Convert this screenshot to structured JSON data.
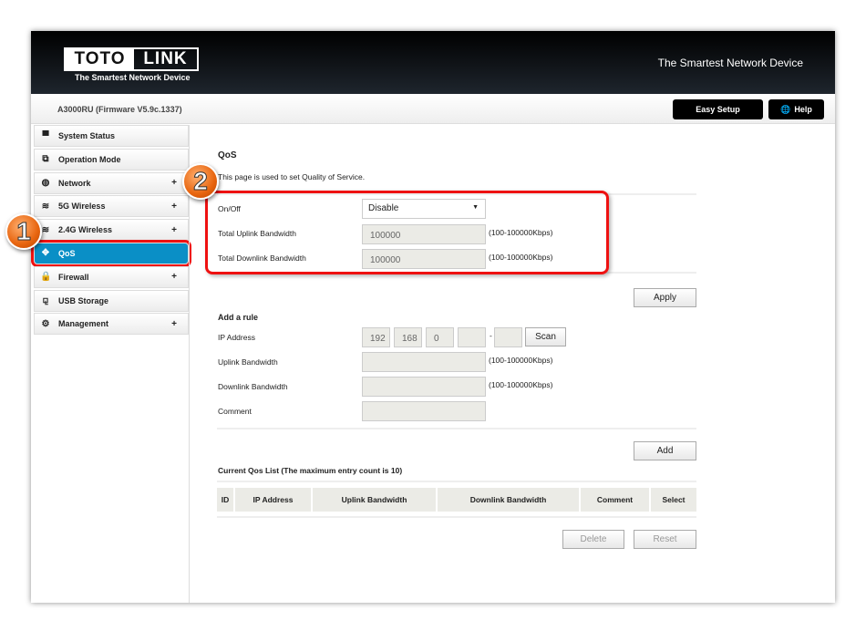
{
  "header": {
    "logo_left": "TOTO",
    "logo_right": "LINK",
    "logo_tagline": "The Smartest Network Device",
    "tagline": "The Smartest Network Device"
  },
  "subbar": {
    "model": "A3000RU (Firmware V5.9c.1337)",
    "easy_setup": "Easy Setup",
    "help": "Help"
  },
  "sidebar": {
    "items": [
      {
        "label": "System Status",
        "icon": "monitor-icon",
        "plus": ""
      },
      {
        "label": "Operation Mode",
        "icon": "windows-icon",
        "plus": ""
      },
      {
        "label": "Network",
        "icon": "globe-icon",
        "plus": "+"
      },
      {
        "label": "5G Wireless",
        "icon": "wifi-icon",
        "plus": "+"
      },
      {
        "label": "2.4G Wireless",
        "icon": "wifi-icon",
        "plus": "+"
      },
      {
        "label": "QoS",
        "icon": "qos-icon",
        "plus": ""
      },
      {
        "label": "Firewall",
        "icon": "lock-icon",
        "plus": "+"
      },
      {
        "label": "USB Storage",
        "icon": "usb-icon",
        "plus": ""
      },
      {
        "label": "Management",
        "icon": "gear-icon",
        "plus": "+"
      }
    ]
  },
  "main": {
    "title": "QoS",
    "description": "This page is used to set Quality of Service.",
    "onoff_label": "On/Off",
    "onoff_value": "Disable",
    "uplink_label": "Total Uplink Bandwidth",
    "uplink_value": "100000",
    "downlink_label": "Total Downlink Bandwidth",
    "downlink_value": "100000",
    "range_hint": "(100-100000Kbps)",
    "apply": "Apply",
    "add_rule_title": "Add a rule",
    "ip_label": "IP Address",
    "ip": [
      "192",
      "168",
      "0",
      "",
      ""
    ],
    "ip_dash": "-",
    "scan": "Scan",
    "rule_uplink_label": "Uplink Bandwidth",
    "rule_downlink_label": "Downlink Bandwidth",
    "comment_label": "Comment",
    "add": "Add",
    "list_title": "Current Qos List  (The maximum entry count is 10)",
    "columns": [
      "ID",
      "IP Address",
      "Uplink Bandwidth",
      "Downlink Bandwidth",
      "Comment",
      "Select"
    ],
    "delete": "Delete",
    "reset": "Reset"
  },
  "annotations": {
    "step1": "1",
    "step2": "2",
    "highlight_color": "#ee1111"
  },
  "colors": {
    "active": "#0a8fc6"
  }
}
